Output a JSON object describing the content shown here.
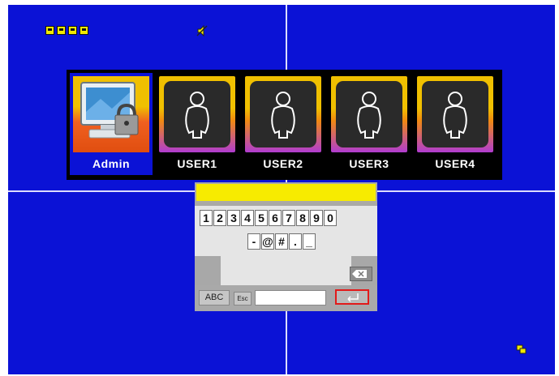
{
  "users": [
    {
      "label": "Admin",
      "selected": true,
      "icon": "admin-lock-icon"
    },
    {
      "label": "USER1",
      "selected": false,
      "icon": "user-icon"
    },
    {
      "label": "USER2",
      "selected": false,
      "icon": "user-icon"
    },
    {
      "label": "USER3",
      "selected": false,
      "icon": "user-icon"
    },
    {
      "label": "USER4",
      "selected": false,
      "icon": "user-icon"
    }
  ],
  "password": {
    "value": ""
  },
  "keypad": {
    "row1": [
      "1",
      "2",
      "3",
      "4",
      "5",
      "6",
      "7",
      "8",
      "9",
      "0"
    ],
    "row2": [
      "-",
      "@",
      "#",
      ".",
      "_"
    ],
    "abc_label": "ABC",
    "esc_label": "Esc",
    "backspace_icon": "backspace-icon",
    "enter_icon": "enter-icon"
  },
  "status": {
    "channel_icons": 4,
    "mute_icon": "mute-icon",
    "corner_icon": "channel-switch-icon"
  },
  "colors": {
    "background": "#0b12d6",
    "grid": "#dcdcff",
    "accent": "#f7eb00",
    "enter_border": "#e21a1a"
  }
}
